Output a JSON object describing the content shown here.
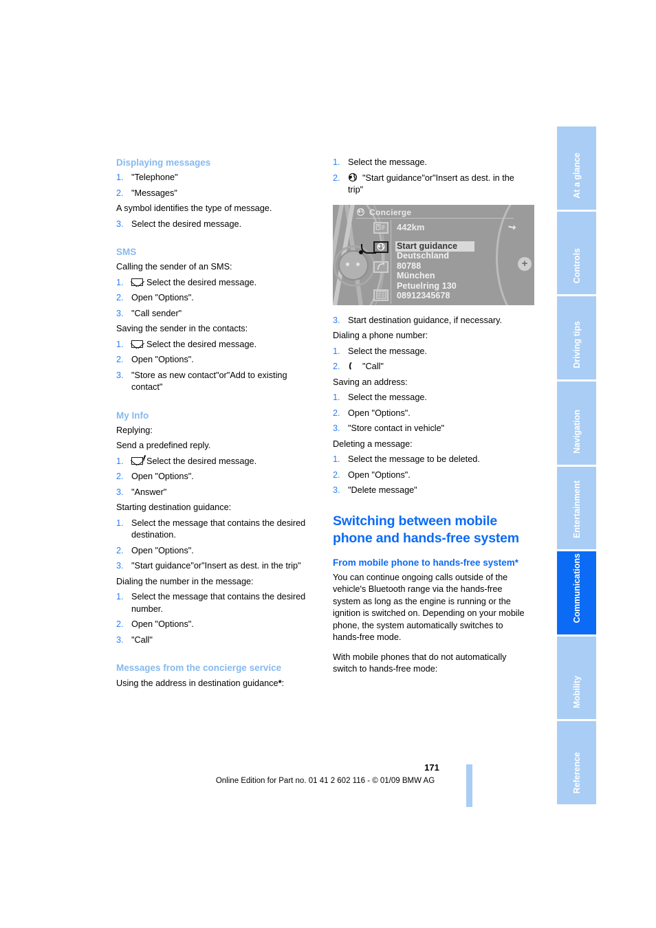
{
  "document": {
    "page_number": "171",
    "footer": "Online Edition for Part no. 01 41 2 602 116 - © 01/09 BMW AG",
    "accent_heading": "#0c6bf5",
    "accent_subheading": "#86b9ef",
    "accent_number": "#2b7ff5",
    "tab_inactive": "#a9cdf5",
    "tab_active": "#0c6bf5"
  },
  "side_tabs": [
    {
      "label": "At a glance",
      "active": false
    },
    {
      "label": "Controls",
      "active": false
    },
    {
      "label": "Driving tips",
      "active": false
    },
    {
      "label": "Navigation",
      "active": false
    },
    {
      "label": "Entertainment",
      "active": false
    },
    {
      "label": "Communications",
      "active": true
    },
    {
      "label": "Mobility",
      "active": false
    },
    {
      "label": "Reference",
      "active": false
    }
  ],
  "left_column": {
    "displaying_messages": {
      "heading": "Displaying messages",
      "step1_num": "1.",
      "step1": "\"Telephone\"",
      "step2_num": "2.",
      "step2": "\"Messages\"",
      "note": "A symbol identifies the type of message.",
      "step3_num": "3.",
      "step3": "Select the desired message."
    },
    "sms": {
      "heading": "SMS",
      "intro_call": "Calling the sender of an SMS:",
      "call_step1_num": "1.",
      "call_step1": "Select the desired message.",
      "call_step2_num": "2.",
      "call_step2": "Open \"Options\".",
      "call_step3_num": "3.",
      "call_step3": "\"Call sender\"",
      "intro_save": "Saving the sender in the contacts:",
      "save_step1_num": "1.",
      "save_step1": "Select the desired message.",
      "save_step2_num": "2.",
      "save_step2": "Open \"Options\".",
      "save_step3_num": "3.",
      "save_step3": "\"Store as new contact\"or\"Add to existing contact\""
    },
    "my_info": {
      "heading": "My Info",
      "intro_reply": "Replying:",
      "reply_note": "Send a predefined reply.",
      "reply_step1_num": "1.",
      "reply_step1": "Select the desired message.",
      "reply_step2_num": "2.",
      "reply_step2": "Open \"Options\".",
      "reply_step3_num": "3.",
      "reply_step3": "\"Answer\"",
      "intro_guidance": "Starting destination guidance:",
      "guid_step1_num": "1.",
      "guid_step1": "Select the message that contains the desired destination.",
      "guid_step2_num": "2.",
      "guid_step2": "Open \"Options\".",
      "guid_step3_num": "3.",
      "guid_step3": "\"Start guidance\"or\"Insert as dest. in the trip\"",
      "intro_dial": "Dialing the number in the message:",
      "dial_step1_num": "1.",
      "dial_step1": "Select the message that contains the desired number.",
      "dial_step2_num": "2.",
      "dial_step2": "Open \"Options\".",
      "dial_step3_num": "3.",
      "dial_step3": "\"Call\""
    },
    "concierge": {
      "heading": "Messages from the concierge service",
      "intro": "Using the address in destination guidance",
      "asterisk": "*",
      "colon": ":"
    }
  },
  "right_column": {
    "address_guidance": {
      "step1_num": "1.",
      "step1": "Select the message.",
      "step2_num": "2.",
      "step2": "\"Start guidance\"or\"Insert as dest. in the trip\"",
      "step3_num": "3.",
      "step3": "Start destination guidance, if necessary."
    },
    "idrive_screenshot": {
      "title": "Concierge",
      "distance": "442km",
      "selected_item": "Start guidance",
      "address_lines": [
        "Deutschland",
        "80788",
        "München",
        "Petuelring 130",
        "08912345678"
      ]
    },
    "dial_number": {
      "intro": "Dialing a phone number:",
      "step1_num": "1.",
      "step1": "Select the message.",
      "step2_num": "2.",
      "step2": "\"Call\""
    },
    "save_address": {
      "intro": "Saving an address:",
      "step1_num": "1.",
      "step1": "Select the message.",
      "step2_num": "2.",
      "step2": "Open \"Options\".",
      "step3_num": "3.",
      "step3": "\"Store contact in vehicle\""
    },
    "delete_message": {
      "intro": "Deleting a message:",
      "step1_num": "1.",
      "step1": "Select the message to be deleted.",
      "step2_num": "2.",
      "step2": "Open \"Options\".",
      "step3_num": "3.",
      "step3": "\"Delete message\""
    },
    "switching": {
      "heading": "Switching between mobile phone and hands-free system",
      "sub_heading": "From mobile phone to hands-free system*",
      "para1": "You can continue ongoing calls outside of the vehicle's Bluetooth range via the hands-free system as long as the engine is running or the ignition is switched on. Depending on your mobile phone, the system automatically switches to hands-free mode.",
      "para2": "With mobile phones that do not automatically switch to hands-free mode:"
    }
  }
}
